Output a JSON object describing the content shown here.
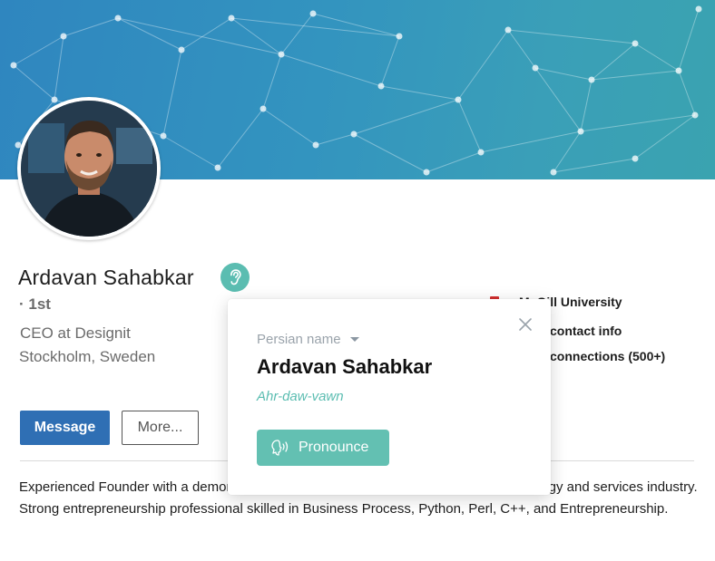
{
  "profile": {
    "name": "Ardavan Sahabkar",
    "degree": "· 1st",
    "headline": "CEO at Designit",
    "location": "Stockholm, Sweden",
    "school": "McGill University",
    "contact_info": "contact info",
    "connections": "connections (500+)",
    "summary": "Experienced Founder with a demonstrated history of working in the information technology and services industry. Strong entrepreneurship professional skilled in Business Process, Python, Perl, C++, and Entrepreneurship."
  },
  "actions": {
    "message_label": "Message",
    "more_label": "More..."
  },
  "pronunciation_popup": {
    "language": "Persian name",
    "name": "Ardavan Sahabkar",
    "phonetic": "Ahr-daw-vawn",
    "button_label": "Pronounce"
  },
  "icons": {
    "ear_badge": "ear-icon",
    "close": "close-icon",
    "pronounce": "speaking-head-icon"
  },
  "colors": {
    "banner": "#3394bf",
    "accent_teal": "#5bbdb1",
    "message_button": "#2f6fb4"
  }
}
